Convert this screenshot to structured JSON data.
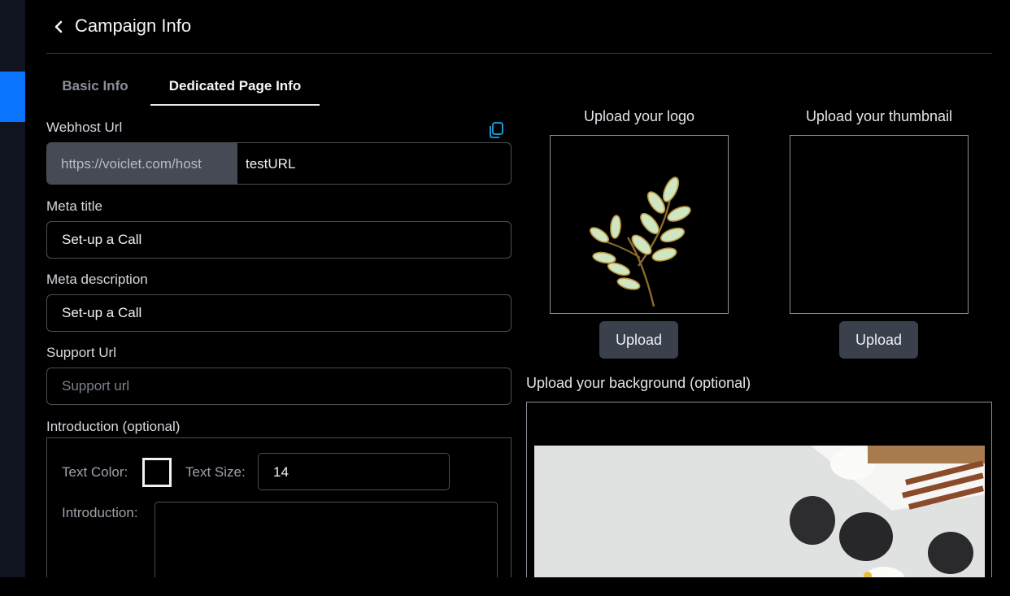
{
  "header": {
    "title": "Campaign Info"
  },
  "tabs": [
    {
      "label": "Basic Info",
      "active": false
    },
    {
      "label": "Dedicated Page Info",
      "active": true
    }
  ],
  "form": {
    "webhost_url": {
      "label": "Webhost Url",
      "prefix": "https://voiclet.com/host",
      "value": "testURL"
    },
    "meta_title": {
      "label": "Meta title",
      "value": "Set-up a Call"
    },
    "meta_description": {
      "label": "Meta description",
      "value": "Set-up a Call"
    },
    "support_url": {
      "label": "Support Url",
      "placeholder": "Support url"
    },
    "introduction": {
      "label": "Introduction (optional)",
      "text_color_label": "Text Color:",
      "text_color": "#000000",
      "text_size_label": "Text Size:",
      "text_size": "14",
      "intro_label": "Introduction:"
    }
  },
  "uploads": {
    "logo": {
      "title": "Upload your logo",
      "button": "Upload"
    },
    "thumbnail": {
      "title": "Upload your thumbnail",
      "button": "Upload"
    },
    "background": {
      "title": "Upload your background (optional)"
    }
  },
  "icons": {
    "back": "chevron-left-icon",
    "copy": "copy-icon"
  },
  "colors": {
    "accent": "#0b74ff",
    "background": "#000000",
    "field_border": "#4a4e57",
    "button": "#3a404c"
  }
}
